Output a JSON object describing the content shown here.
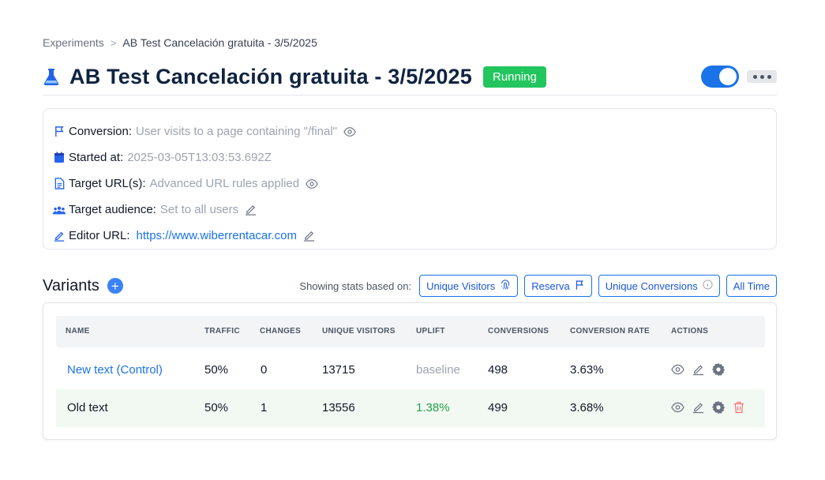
{
  "breadcrumb": {
    "parent": "Experiments",
    "separator": ">",
    "current": "AB Test Cancelación gratuita - 3/5/2025"
  },
  "header": {
    "title": "AB Test Cancelación gratuita - 3/5/2025",
    "status": "Running",
    "toggle_on": true
  },
  "info": {
    "conversion_label": "Conversion:",
    "conversion_value": "User visits to a page containing \"/final\"",
    "started_label": "Started at:",
    "started_value": "2025-03-05T13:03:53.692Z",
    "target_url_label": "Target URL(s):",
    "target_url_value": "Advanced URL rules applied",
    "audience_label": "Target audience:",
    "audience_value": "Set to all users",
    "editor_label": "Editor URL:",
    "editor_value": "https://www.wiberrentacar.com"
  },
  "variants": {
    "title": "Variants",
    "stats_label": "Showing stats based on:",
    "filters": {
      "metric": "Unique Visitors",
      "goal": "Reserva",
      "conversion_type": "Unique Conversions",
      "range": "All Time"
    },
    "columns": {
      "name": "NAME",
      "traffic": "TRAFFIC",
      "changes": "CHANGES",
      "unique_visitors": "UNIQUE VISITORS",
      "uplift": "UPLIFT",
      "conversions": "CONVERSIONS",
      "conversion_rate": "CONVERSION RATE",
      "actions": "ACTIONS"
    },
    "rows": [
      {
        "name": "New text (Control)",
        "traffic": "50%",
        "changes": "0",
        "unique_visitors": "13715",
        "uplift": "baseline",
        "conversions": "498",
        "conversion_rate": "3.63%"
      },
      {
        "name": "Old text",
        "traffic": "50%",
        "changes": "1",
        "unique_visitors": "13556",
        "uplift": "1.38%",
        "conversions": "499",
        "conversion_rate": "3.68%"
      }
    ]
  },
  "colors": {
    "primary": "#1a73e8",
    "running": "#22c55e",
    "uplift_positive": "#22a046",
    "delete": "#f87171"
  },
  "icons": [
    "flask-icon",
    "flag-icon",
    "calendar-icon",
    "document-icon",
    "users-icon",
    "pencil-icon",
    "eye-icon",
    "plus-icon",
    "fingerprint-icon",
    "info-icon",
    "gear-icon",
    "trash-icon",
    "chevron-right-icon",
    "ellipsis-icon"
  ]
}
